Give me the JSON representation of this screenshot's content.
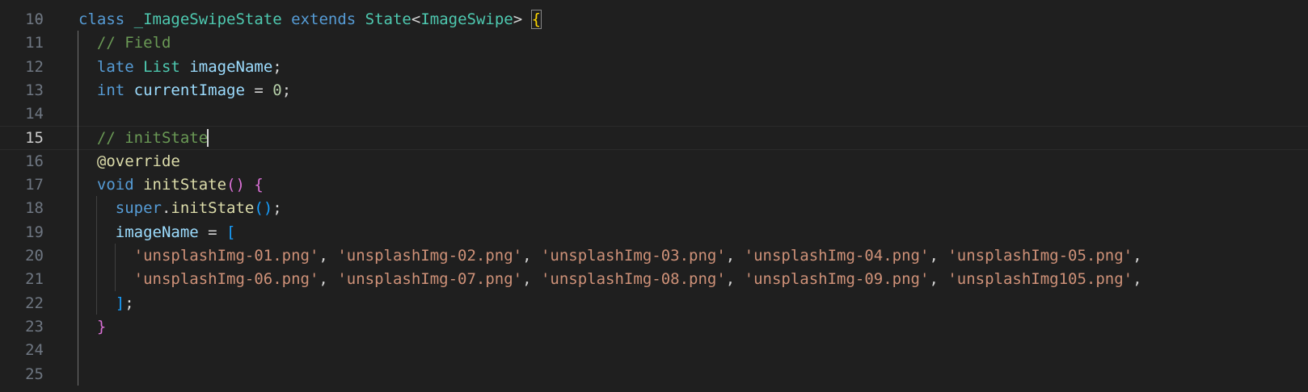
{
  "editor": {
    "top_fragment": "-",
    "lines": [
      {
        "number": "10",
        "tokens": [
          {
            "text": "class",
            "color": "#569cd6"
          },
          {
            "text": " ",
            "color": "#d4d4d4"
          },
          {
            "text": "_ImageSwipeState",
            "color": "#4ec9b0"
          },
          {
            "text": " ",
            "color": "#d4d4d4"
          },
          {
            "text": "extends",
            "color": "#569cd6"
          },
          {
            "text": " ",
            "color": "#d4d4d4"
          },
          {
            "text": "State",
            "color": "#4ec9b0"
          },
          {
            "text": "<",
            "color": "#d4d4d4"
          },
          {
            "text": "ImageSwipe",
            "color": "#4ec9b0"
          },
          {
            "text": ">",
            "color": "#d4d4d4"
          },
          {
            "text": " ",
            "color": "#d4d4d4"
          },
          {
            "text": "{",
            "color": "#ffd700",
            "match": true
          }
        ]
      },
      {
        "number": "11",
        "tokens": [
          {
            "text": "  "
          },
          {
            "text": "// Field",
            "color": "#6a9955"
          }
        ]
      },
      {
        "number": "12",
        "tokens": [
          {
            "text": "  "
          },
          {
            "text": "late",
            "color": "#569cd6"
          },
          {
            "text": " "
          },
          {
            "text": "List",
            "color": "#4ec9b0"
          },
          {
            "text": " "
          },
          {
            "text": "imageName",
            "color": "#9cdcfe"
          },
          {
            "text": ";",
            "color": "#d4d4d4"
          }
        ]
      },
      {
        "number": "13",
        "tokens": [
          {
            "text": "  "
          },
          {
            "text": "int",
            "color": "#569cd6"
          },
          {
            "text": " "
          },
          {
            "text": "currentImage",
            "color": "#9cdcfe"
          },
          {
            "text": " = ",
            "color": "#d4d4d4"
          },
          {
            "text": "0",
            "color": "#b5cea8"
          },
          {
            "text": ";",
            "color": "#d4d4d4"
          }
        ]
      },
      {
        "number": "14",
        "tokens": []
      },
      {
        "number": "15",
        "current": true,
        "tokens": [
          {
            "text": "  "
          },
          {
            "text": "// initState",
            "color": "#6a9955",
            "cursor": true
          }
        ]
      },
      {
        "number": "16",
        "tokens": [
          {
            "text": "  "
          },
          {
            "text": "@override",
            "color": "#dcdcaa"
          }
        ]
      },
      {
        "number": "17",
        "tokens": [
          {
            "text": "  "
          },
          {
            "text": "void",
            "color": "#569cd6"
          },
          {
            "text": " "
          },
          {
            "text": "initState",
            "color": "#dcdcaa"
          },
          {
            "text": "()",
            "color": "#da70d6"
          },
          {
            "text": " "
          },
          {
            "text": "{",
            "color": "#da70d6"
          }
        ]
      },
      {
        "number": "18",
        "tokens": [
          {
            "text": "    "
          },
          {
            "text": "super",
            "color": "#569cd6"
          },
          {
            "text": ".",
            "color": "#d4d4d4"
          },
          {
            "text": "initState",
            "color": "#dcdcaa"
          },
          {
            "text": "()",
            "color": "#179fff"
          },
          {
            "text": ";",
            "color": "#d4d4d4"
          }
        ]
      },
      {
        "number": "19",
        "tokens": [
          {
            "text": "    "
          },
          {
            "text": "imageName",
            "color": "#9cdcfe"
          },
          {
            "text": " = ",
            "color": "#d4d4d4"
          },
          {
            "text": "[",
            "color": "#179fff"
          }
        ]
      },
      {
        "number": "20",
        "tokens": [
          {
            "text": "      "
          },
          {
            "text": "'unsplashImg-01.png'",
            "color": "#ce9178"
          },
          {
            "text": ", ",
            "color": "#d4d4d4"
          },
          {
            "text": "'unsplashImg-02.png'",
            "color": "#ce9178"
          },
          {
            "text": ", ",
            "color": "#d4d4d4"
          },
          {
            "text": "'unsplashImg-03.png'",
            "color": "#ce9178"
          },
          {
            "text": ", ",
            "color": "#d4d4d4"
          },
          {
            "text": "'unsplashImg-04.png'",
            "color": "#ce9178"
          },
          {
            "text": ", ",
            "color": "#d4d4d4"
          },
          {
            "text": "'unsplashImg-05.png'",
            "color": "#ce9178"
          },
          {
            "text": ",",
            "color": "#d4d4d4"
          }
        ]
      },
      {
        "number": "21",
        "tokens": [
          {
            "text": "      "
          },
          {
            "text": "'unsplashImg-06.png'",
            "color": "#ce9178"
          },
          {
            "text": ", ",
            "color": "#d4d4d4"
          },
          {
            "text": "'unsplashImg-07.png'",
            "color": "#ce9178"
          },
          {
            "text": ", ",
            "color": "#d4d4d4"
          },
          {
            "text": "'unsplashImg-08.png'",
            "color": "#ce9178"
          },
          {
            "text": ", ",
            "color": "#d4d4d4"
          },
          {
            "text": "'unsplashImg-09.png'",
            "color": "#ce9178"
          },
          {
            "text": ", ",
            "color": "#d4d4d4"
          },
          {
            "text": "'unsplashImg105.png'",
            "color": "#ce9178"
          },
          {
            "text": ",",
            "color": "#d4d4d4"
          }
        ]
      },
      {
        "number": "22",
        "tokens": [
          {
            "text": "    "
          },
          {
            "text": "]",
            "color": "#179fff"
          },
          {
            "text": ";",
            "color": "#d4d4d4"
          }
        ]
      },
      {
        "number": "23",
        "tokens": [
          {
            "text": "  "
          },
          {
            "text": "}",
            "color": "#da70d6"
          }
        ]
      },
      {
        "number": "24",
        "tokens": []
      },
      {
        "number": "25",
        "tokens": []
      }
    ]
  }
}
